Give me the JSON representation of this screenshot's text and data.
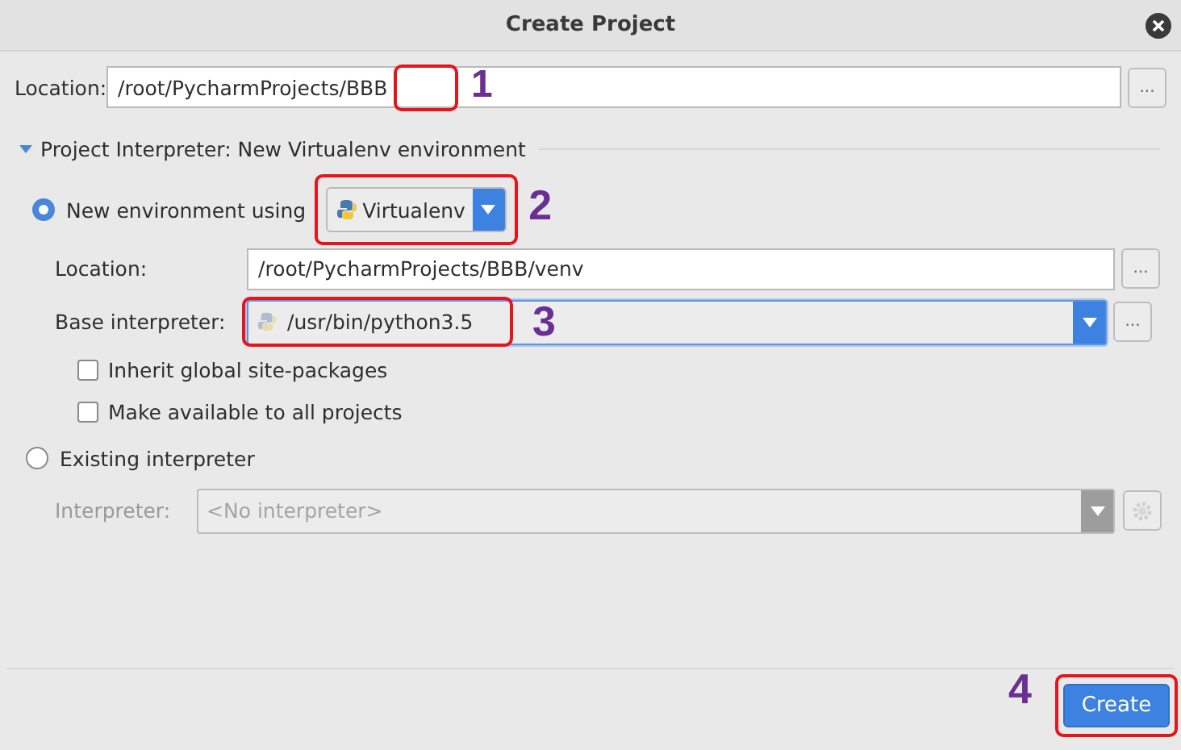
{
  "window": {
    "title": "Create Project"
  },
  "location": {
    "label": "Location:",
    "value": "/root/PycharmProjects/BBB",
    "browse": "...",
    "annotation": "1"
  },
  "section": {
    "title": "Project Interpreter: New Virtualenv environment",
    "expanded": true
  },
  "new_environment": {
    "label": "New environment using",
    "selected": true,
    "tool": {
      "value": "Virtualenv",
      "annotation": "2"
    },
    "location": {
      "label": "Location:",
      "value": "/root/PycharmProjects/BBB/venv",
      "browse": "..."
    },
    "base_interpreter": {
      "label": "Base interpreter:",
      "value": "/usr/bin/python3.5",
      "browse": "...",
      "annotation": "3"
    },
    "checkboxes": [
      {
        "label": "Inherit global site-packages",
        "checked": false
      },
      {
        "label": "Make available to all projects",
        "checked": false
      }
    ]
  },
  "existing_interpreter": {
    "label": "Existing interpreter",
    "selected": false,
    "interpreter": {
      "label": "Interpreter:",
      "placeholder": "<No interpreter>",
      "disabled": true
    }
  },
  "create_button": {
    "label": "Create",
    "annotation": "4"
  }
}
